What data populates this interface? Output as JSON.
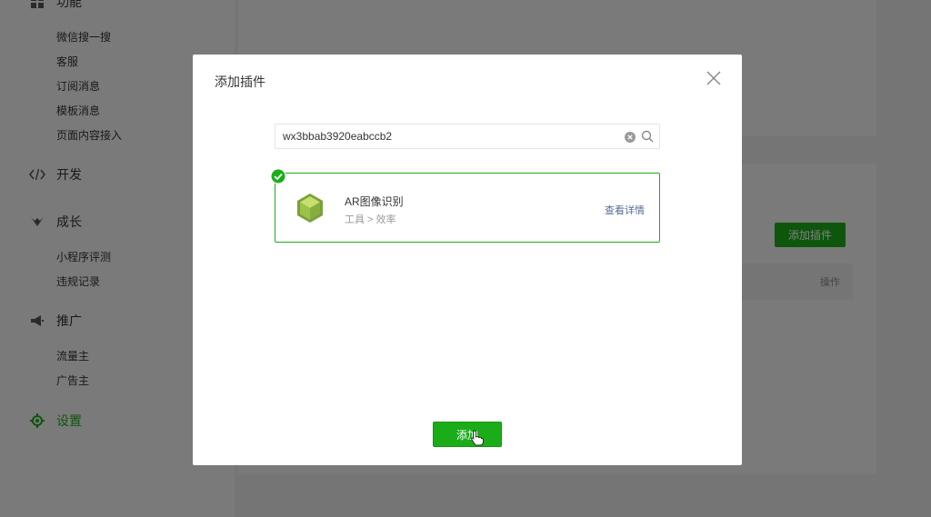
{
  "sidebar": {
    "sections": [
      {
        "label": "功能",
        "icon": "grid-icon"
      },
      {
        "label": "开发",
        "icon": "code-icon"
      },
      {
        "label": "成长",
        "icon": "growth-icon"
      },
      {
        "label": "推广",
        "icon": "megaphone-icon"
      },
      {
        "label": "设置",
        "icon": "gear-icon"
      }
    ],
    "feature_items": [
      "微信搜一搜",
      "客服",
      "订阅消息",
      "模板消息",
      "页面内容接入"
    ],
    "growth_items": [
      "小程序评测",
      "违规记录"
    ],
    "promo_items": [
      "流量主",
      "广告主"
    ]
  },
  "background": {
    "add_plugin_label": "添加插件",
    "table_action_header": "操作"
  },
  "modal": {
    "title": "添加插件",
    "search": {
      "value": "wx3bbab3920eabccb2"
    },
    "result": {
      "name": "AR图像识别",
      "category": "工具 > 效率",
      "detail_link": "查看详情"
    },
    "add_button": "添加"
  },
  "colors": {
    "accent": "#1aad19",
    "link": "#576b95"
  }
}
